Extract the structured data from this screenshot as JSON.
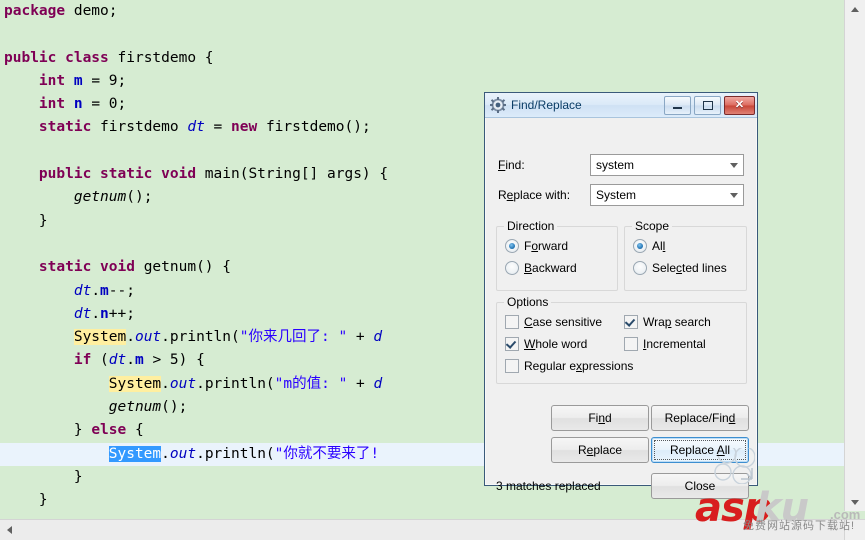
{
  "editor": {
    "background": "#d6ecd2",
    "lines": [
      [
        {
          "t": "package ",
          "c": "kw"
        },
        {
          "t": "demo",
          "c": "plain"
        },
        {
          "t": ";",
          "c": "plain"
        }
      ],
      [],
      [
        {
          "t": "public class ",
          "c": "kw"
        },
        {
          "t": "firstdemo",
          "c": "plain"
        },
        {
          "t": " {",
          "c": "plain"
        }
      ],
      [
        {
          "t": "    ",
          "c": "plain"
        },
        {
          "t": "int",
          "c": "kw"
        },
        {
          "t": " ",
          "c": "plain"
        },
        {
          "t": "m",
          "c": "fld"
        },
        {
          "t": " = ",
          "c": "plain"
        },
        {
          "t": "9",
          "c": "plain"
        },
        {
          "t": ";",
          "c": "plain"
        }
      ],
      [
        {
          "t": "    ",
          "c": "plain"
        },
        {
          "t": "int",
          "c": "kw"
        },
        {
          "t": " ",
          "c": "plain"
        },
        {
          "t": "n",
          "c": "fld"
        },
        {
          "t": " = ",
          "c": "plain"
        },
        {
          "t": "0",
          "c": "plain"
        },
        {
          "t": ";",
          "c": "plain"
        }
      ],
      [
        {
          "t": "    ",
          "c": "plain"
        },
        {
          "t": "static",
          "c": "kw"
        },
        {
          "t": " firstdemo ",
          "c": "plain"
        },
        {
          "t": "dt",
          "c": "stat"
        },
        {
          "t": " = ",
          "c": "plain"
        },
        {
          "t": "new",
          "c": "kw"
        },
        {
          "t": " firstdemo();",
          "c": "plain"
        }
      ],
      [],
      [
        {
          "t": "    ",
          "c": "plain"
        },
        {
          "t": "public static void ",
          "c": "kw"
        },
        {
          "t": "main(String[] args) {",
          "c": "plain"
        }
      ],
      [
        {
          "t": "        ",
          "c": "plain"
        },
        {
          "t": "getnum",
          "c": "mth"
        },
        {
          "t": "();",
          "c": "plain"
        }
      ],
      [
        {
          "t": "    }",
          "c": "plain"
        }
      ],
      [],
      [
        {
          "t": "    ",
          "c": "plain"
        },
        {
          "t": "static void ",
          "c": "kw"
        },
        {
          "t": "getnum() {",
          "c": "plain"
        }
      ],
      [
        {
          "t": "        ",
          "c": "plain"
        },
        {
          "t": "dt",
          "c": "stat"
        },
        {
          "t": ".",
          "c": "plain"
        },
        {
          "t": "m",
          "c": "fld"
        },
        {
          "t": "--;",
          "c": "plain"
        }
      ],
      [
        {
          "t": "        ",
          "c": "plain"
        },
        {
          "t": "dt",
          "c": "stat"
        },
        {
          "t": ".",
          "c": "plain"
        },
        {
          "t": "n",
          "c": "fld"
        },
        {
          "t": "++;",
          "c": "plain"
        }
      ],
      [
        {
          "t": "        ",
          "c": "plain"
        },
        {
          "t": "System",
          "c": "hl"
        },
        {
          "t": ".",
          "c": "plain"
        },
        {
          "t": "out",
          "c": "stat"
        },
        {
          "t": ".println(",
          "c": "plain"
        },
        {
          "t": "\"你来几回了: \"",
          "c": "str"
        },
        {
          "t": " + ",
          "c": "plain"
        },
        {
          "t": "d",
          "c": "stat"
        }
      ],
      [
        {
          "t": "        ",
          "c": "plain"
        },
        {
          "t": "if",
          "c": "kw"
        },
        {
          "t": " (",
          "c": "plain"
        },
        {
          "t": "dt",
          "c": "stat"
        },
        {
          "t": ".",
          "c": "plain"
        },
        {
          "t": "m",
          "c": "fld"
        },
        {
          "t": " > ",
          "c": "plain"
        },
        {
          "t": "5",
          "c": "plain"
        },
        {
          "t": ") {",
          "c": "plain"
        }
      ],
      [
        {
          "t": "            ",
          "c": "plain"
        },
        {
          "t": "System",
          "c": "hl"
        },
        {
          "t": ".",
          "c": "plain"
        },
        {
          "t": "out",
          "c": "stat"
        },
        {
          "t": ".println(",
          "c": "plain"
        },
        {
          "t": "\"m的值: \"",
          "c": "str"
        },
        {
          "t": " + ",
          "c": "plain"
        },
        {
          "t": "d",
          "c": "stat"
        }
      ],
      [
        {
          "t": "            ",
          "c": "plain"
        },
        {
          "t": "getnum",
          "c": "mth"
        },
        {
          "t": "();",
          "c": "plain"
        }
      ],
      [
        {
          "t": "        } ",
          "c": "plain"
        },
        {
          "t": "else",
          "c": "kw"
        },
        {
          "t": " {",
          "c": "plain"
        }
      ],
      [
        {
          "t": "            ",
          "c": "plain"
        },
        {
          "t": "System",
          "c": "sel"
        },
        {
          "t": ".",
          "c": "plain"
        },
        {
          "t": "out",
          "c": "stat"
        },
        {
          "t": ".println(",
          "c": "plain"
        },
        {
          "t": "\"你就不要来了!",
          "c": "str"
        }
      ],
      [
        {
          "t": "        }",
          "c": "plain"
        }
      ],
      [
        {
          "t": "    }",
          "c": "plain"
        }
      ],
      [
        {
          "t": "}",
          "c": "plain"
        }
      ]
    ],
    "current_line_index": 19,
    "vscroll": {
      "up_arrow": "scroll-up",
      "down_arrow": "scroll-down"
    },
    "hscroll": {
      "left_arrow": "scroll-left"
    }
  },
  "dialog": {
    "title": "Find/Replace",
    "icon": "gear-icon",
    "window_buttons": {
      "minimize": "Minimize",
      "restore": "Restore",
      "close": "Close"
    },
    "find": {
      "label": "Find:",
      "label_mnemonic": "F",
      "value": "system"
    },
    "replace": {
      "label": "Replace with:",
      "label_mnemonic": "e",
      "value": "System"
    },
    "direction": {
      "title": "Direction",
      "options": [
        {
          "label": "Forward",
          "mnemonic": "o",
          "selected": true
        },
        {
          "label": "Backward",
          "mnemonic": "B",
          "selected": false
        }
      ]
    },
    "scope": {
      "title": "Scope",
      "options": [
        {
          "label": "All",
          "mnemonic": "l",
          "selected": true
        },
        {
          "label": "Selected lines",
          "mnemonic": "c",
          "selected": false
        }
      ]
    },
    "options": {
      "title": "Options",
      "items": [
        {
          "label": "Case sensitive",
          "mnemonic": "C",
          "checked": false
        },
        {
          "label": "Wrap search",
          "mnemonic": "p",
          "checked": true
        },
        {
          "label": "Whole word",
          "mnemonic": "W",
          "checked": true
        },
        {
          "label": "Incremental",
          "mnemonic": "I",
          "checked": false
        },
        {
          "label": "Regular expressions",
          "mnemonic": "x",
          "checked": false
        }
      ]
    },
    "buttons": {
      "find": "Find",
      "replace_find": "Replace/Find",
      "replace": "Replace",
      "replace_all": "Replace All",
      "close": "Close"
    },
    "focused_button": "Replace All",
    "status": "3 matches replaced"
  },
  "watermark": {
    "brand_red": "asp",
    "brand_grey": "ku",
    "tld": ".com",
    "subtitle": "免费网站源码下载站!",
    "red": "#d81e1e",
    "grey": "#c9c9c9"
  }
}
